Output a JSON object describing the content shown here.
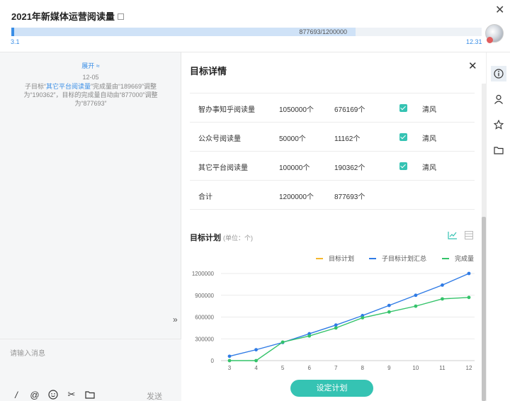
{
  "header": {
    "title": "2021年新媒体运营阅读量",
    "progress_text": "877693/1200000",
    "progress_fraction": 0.7314,
    "date_start": "3.1",
    "date_end": "12.31"
  },
  "chat": {
    "expand_label": "展开 ≈",
    "date": "12-05",
    "message_pre": "子目标“",
    "message_link": "其它平台阅读量",
    "message_post": "”完成量由“189669”调整为“190362”，目标的完成量自动由“877000”调整为“877693”",
    "input_placeholder": "请输入消息",
    "send_label": "发送"
  },
  "detail": {
    "title": "目标详情",
    "rows": [
      {
        "name": "智办事知乎阅读量",
        "target": "1050000个",
        "done": "676169个",
        "owner": "清风"
      },
      {
        "name": "公众号阅读量",
        "target": "50000个",
        "done": "11162个",
        "owner": "清风"
      },
      {
        "name": "其它平台阅读量",
        "target": "100000个",
        "done": "190362个",
        "owner": "清风"
      },
      {
        "name": "合计",
        "target": "1200000个",
        "done": "877693个",
        "owner": ""
      }
    ],
    "plan_title": "目标计划",
    "plan_unit": "(单位：个)",
    "set_plan_label": "设定计划"
  },
  "chart_data": {
    "type": "line",
    "x": [
      3,
      4,
      5,
      6,
      7,
      8,
      9,
      10,
      11,
      12
    ],
    "ylim": [
      0,
      1200000
    ],
    "yticks": [
      0,
      300000,
      600000,
      900000,
      1200000
    ],
    "legend_position": "top-right",
    "grid": true,
    "series": [
      {
        "name": "目标计划",
        "color": "#f5b82e",
        "values": []
      },
      {
        "name": "子目标计划汇总",
        "color": "#2f7be5",
        "values": [
          60000,
          150000,
          250000,
          370000,
          490000,
          620000,
          760000,
          900000,
          1040000,
          1200000
        ]
      },
      {
        "name": "完成量",
        "color": "#34c36a",
        "values": [
          0,
          0,
          255000,
          340000,
          450000,
          590000,
          670000,
          750000,
          850000,
          870000
        ]
      }
    ]
  },
  "colors": {
    "accent": "#3a8ee6",
    "teal": "#35c3b3"
  }
}
